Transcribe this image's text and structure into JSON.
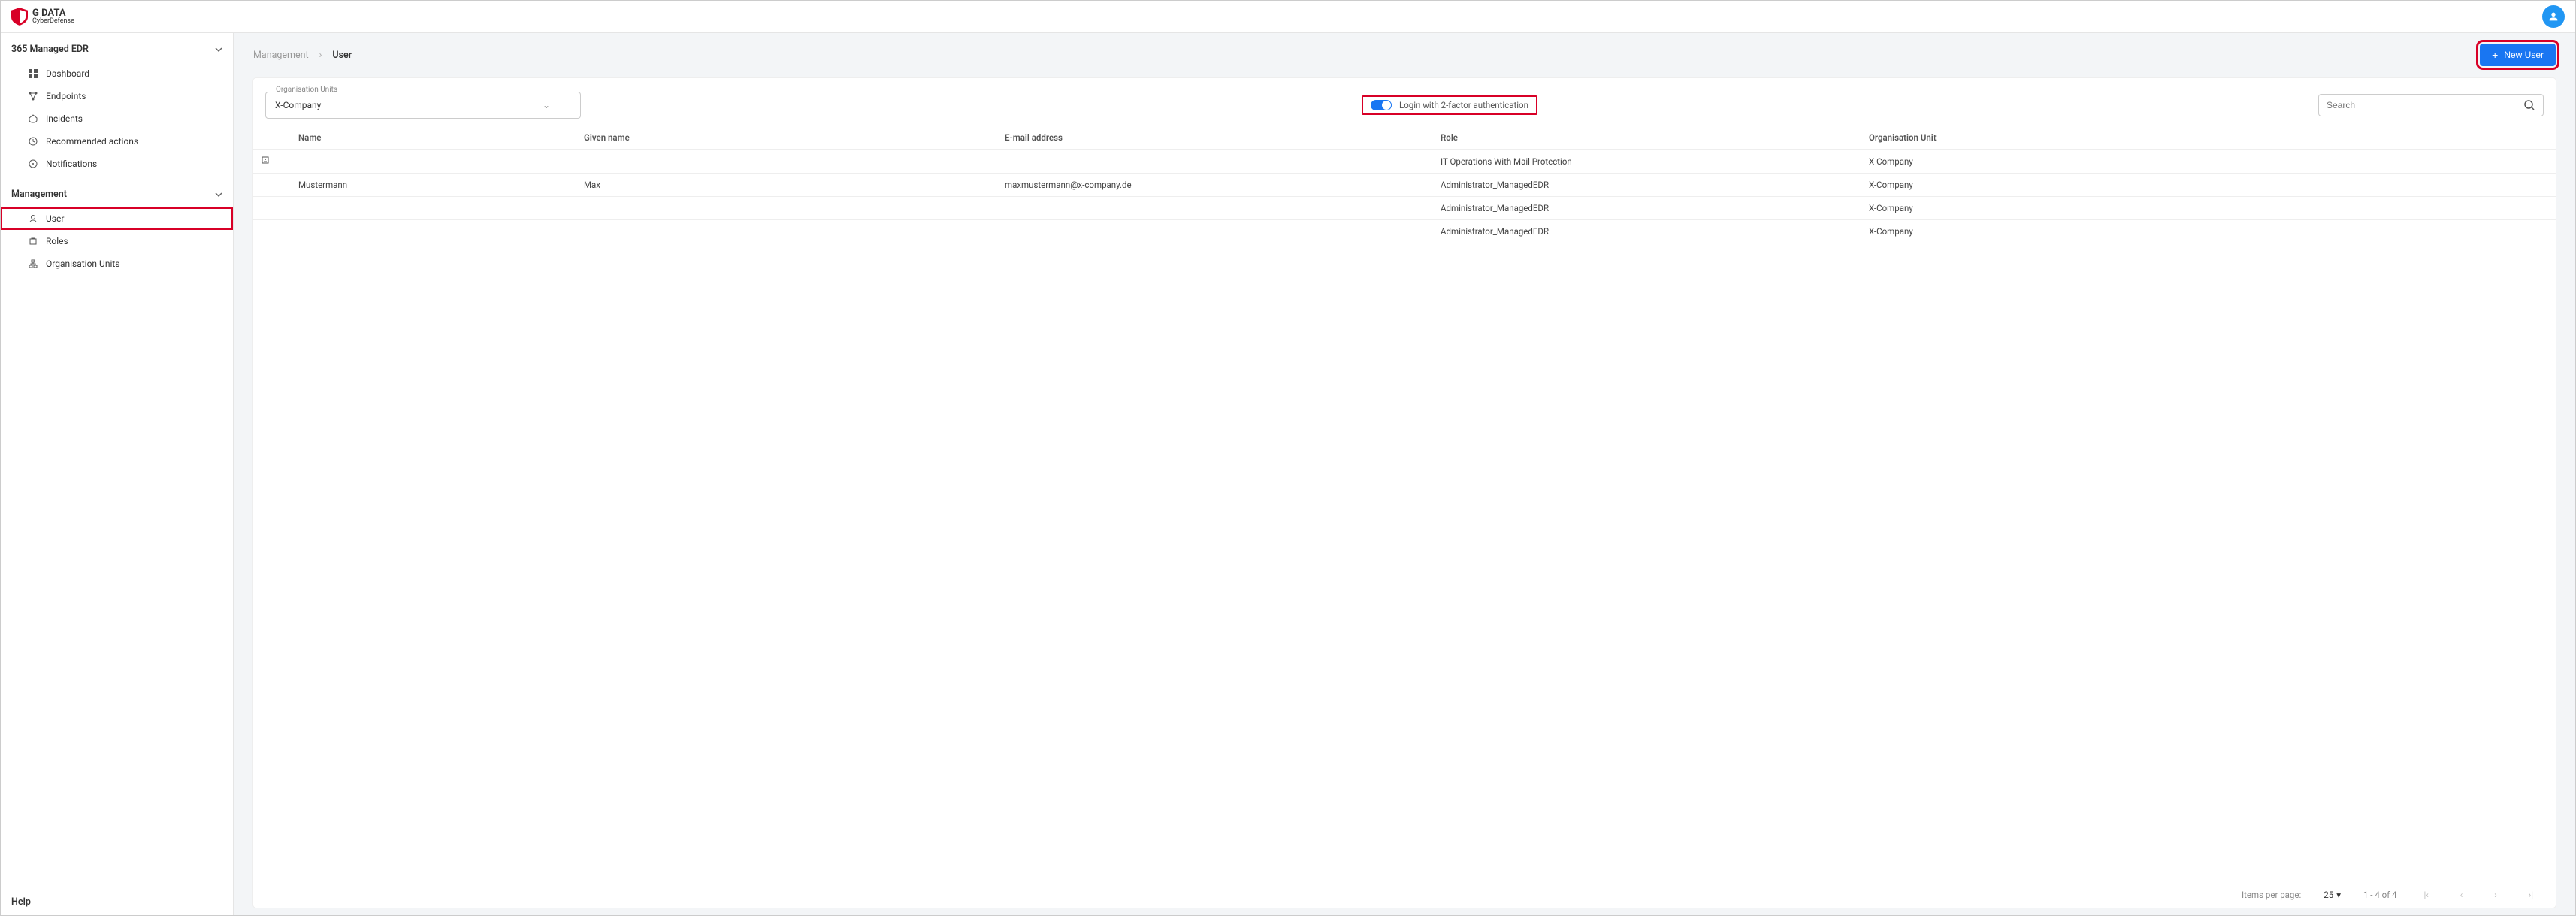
{
  "brand": {
    "main": "G DATA",
    "sub": "CyberDefense"
  },
  "sidebar": {
    "section1": {
      "title": "365 Managed EDR",
      "items": [
        {
          "label": "Dashboard"
        },
        {
          "label": "Endpoints"
        },
        {
          "label": "Incidents"
        },
        {
          "label": "Recommended actions"
        },
        {
          "label": "Notifications"
        }
      ]
    },
    "section2": {
      "title": "Management",
      "items": [
        {
          "label": "User"
        },
        {
          "label": "Roles"
        },
        {
          "label": "Organisation Units"
        }
      ]
    },
    "help": "Help"
  },
  "breadcrumb": {
    "parent": "Management",
    "current": "User"
  },
  "new_user_label": "New User",
  "ou": {
    "legend": "Organisation Units",
    "value": "X-Company"
  },
  "two_fa_label": "Login with 2-factor authentication",
  "search_placeholder": "Search",
  "table": {
    "headers": {
      "name": "Name",
      "given": "Given name",
      "email": "E-mail address",
      "role": "Role",
      "org": "Organisation Unit"
    },
    "rows": [
      {
        "icon": true,
        "name": "",
        "given": "",
        "email": "",
        "role": "IT Operations With Mail Protection",
        "org": "X-Company"
      },
      {
        "icon": false,
        "name": "Mustermann",
        "given": "Max",
        "email": "maxmustermann@x-company.de",
        "role": "Administrator_ManagedEDR",
        "org": "X-Company"
      },
      {
        "icon": false,
        "name": "",
        "given": "",
        "email": "",
        "role": "Administrator_ManagedEDR",
        "org": "X-Company"
      },
      {
        "icon": false,
        "name": "",
        "given": "",
        "email": "",
        "role": "Administrator_ManagedEDR",
        "org": "X-Company"
      }
    ]
  },
  "pagination": {
    "items_per_page": "Items per page:",
    "size": "25",
    "range": "1 - 4 of 4"
  }
}
